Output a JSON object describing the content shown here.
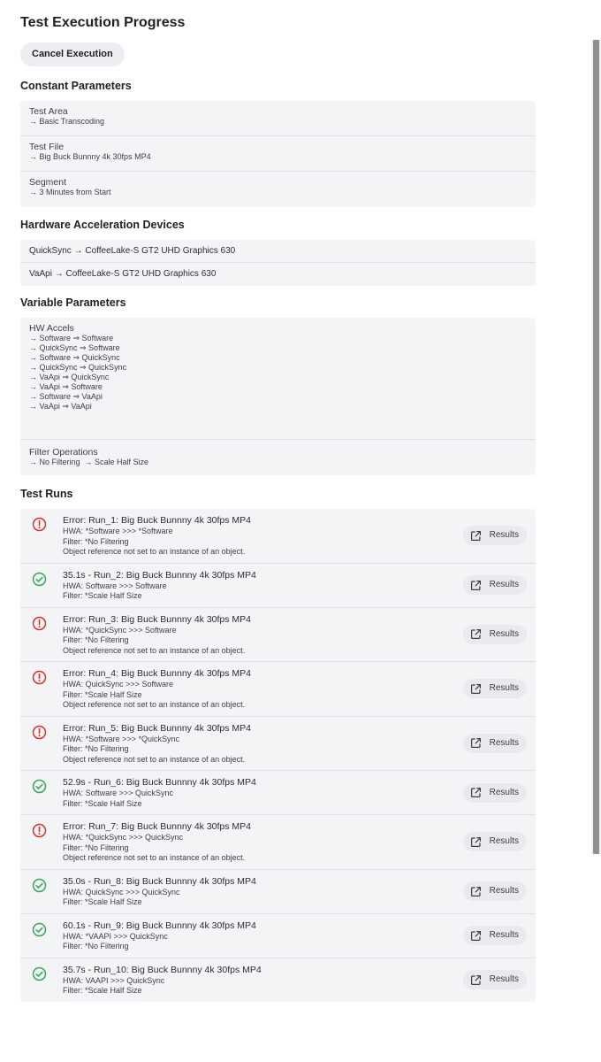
{
  "title": "Test Execution Progress",
  "cancel_label": "Cancel Execution",
  "constant_parameters": {
    "heading": "Constant Parameters",
    "items": [
      {
        "key": "Test Area",
        "value": "→ Basic Transcoding"
      },
      {
        "key": "Test File",
        "value": "→ Big Buck Bunnny 4k 30fps MP4"
      },
      {
        "key": "Segment",
        "value": "→ 3 Minutes from Start"
      }
    ]
  },
  "hardware_devices": {
    "heading": "Hardware Acceleration Devices",
    "items": [
      "QuickSync → CoffeeLake-S GT2 UHD Graphics 630",
      "VaApi → CoffeeLake-S GT2 UHD Graphics 630"
    ]
  },
  "variable_parameters": {
    "heading": "Variable Parameters",
    "hw_accels_label": "HW Accels",
    "hw_accels": [
      "→ Software ⇒ Software",
      "→ QuickSync ⇒ Software",
      "→ Software ⇒ QuickSync",
      "→ QuickSync ⇒ QuickSync",
      "→ VaApi ⇒ QuickSync",
      "→ VaApi ⇒ Software",
      "→ Software ⇒ VaApi",
      "→ VaApi ⇒ VaApi"
    ],
    "filter_label": "Filter Operations",
    "filters": "→ No Filtering  → Scale Half Size"
  },
  "test_runs": {
    "heading": "Test Runs",
    "results_label": "Results",
    "status_colors": {
      "error": "#d93025",
      "success": "#34a853"
    },
    "runs": [
      {
        "status": "error",
        "title": "Error: Run_1: Big Buck Bunnny 4k 30fps MP4",
        "lines": [
          "HWA: *Software >>> *Software",
          "Filter: *No Filtering",
          "Object reference not set to an instance of an object."
        ]
      },
      {
        "status": "success",
        "title": "35.1s - Run_2: Big Buck Bunnny 4k 30fps MP4",
        "lines": [
          "HWA: Software >>> Software",
          "Filter: *Scale Half Size"
        ]
      },
      {
        "status": "error",
        "title": "Error: Run_3: Big Buck Bunnny 4k 30fps MP4",
        "lines": [
          "HWA: *QuickSync >>> Software",
          "Filter: *No Filtering",
          "Object reference not set to an instance of an object."
        ]
      },
      {
        "status": "error",
        "title": "Error: Run_4: Big Buck Bunnny 4k 30fps MP4",
        "lines": [
          "HWA: QuickSync >>> Software",
          "Filter: *Scale Half Size",
          "Object reference not set to an instance of an object."
        ]
      },
      {
        "status": "error",
        "title": "Error: Run_5: Big Buck Bunnny 4k 30fps MP4",
        "lines": [
          "HWA: *Software >>> *QuickSync",
          "Filter: *No Filtering",
          "Object reference not set to an instance of an object."
        ]
      },
      {
        "status": "success",
        "title": "52.9s - Run_6: Big Buck Bunnny 4k 30fps MP4",
        "lines": [
          "HWA: Software >>> QuickSync",
          "Filter: *Scale Half Size"
        ]
      },
      {
        "status": "error",
        "title": "Error: Run_7: Big Buck Bunnny 4k 30fps MP4",
        "lines": [
          "HWA: *QuickSync >>> QuickSync",
          "Filter: *No Filtering",
          "Object reference not set to an instance of an object."
        ]
      },
      {
        "status": "success",
        "title": "35.0s - Run_8: Big Buck Bunnny 4k 30fps MP4",
        "lines": [
          "HWA: QuickSync >>> QuickSync",
          "Filter: *Scale Half Size"
        ]
      },
      {
        "status": "success",
        "title": "60.1s - Run_9: Big Buck Bunnny 4k 30fps MP4",
        "lines": [
          "HWA: *VAAPI >>> QuickSync",
          "Filter: *No Filtering"
        ]
      },
      {
        "status": "success",
        "title": "35.7s - Run_10: Big Buck Bunnny 4k 30fps MP4",
        "lines": [
          "HWA: VAAPI >>> QuickSync",
          "Filter: *Scale Half Size"
        ]
      }
    ]
  }
}
